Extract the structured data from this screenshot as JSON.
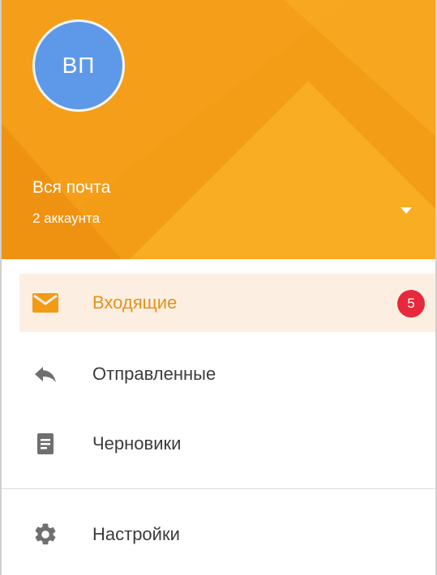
{
  "header": {
    "avatar_initials": "ВП",
    "account_title": "Вся почта",
    "account_subtitle": "2 аккаунта",
    "switch_icon": "caret-down-icon",
    "colors": {
      "background": "#f39c16",
      "avatar": "#5e99e9"
    }
  },
  "nav": {
    "items": [
      {
        "label": "Входящие",
        "icon": "envelope-icon",
        "badge": "5",
        "active": true
      },
      {
        "label": "Отправленные",
        "icon": "reply-icon",
        "active": false
      },
      {
        "label": "Черновики",
        "icon": "document-icon",
        "active": false
      }
    ],
    "settings": {
      "label": "Настройки",
      "icon": "gear-icon"
    }
  },
  "colors": {
    "accent": "#e5911a",
    "active_background": "#fcefe1",
    "badge": "#e8283c",
    "icon_gray": "#6f6f6f"
  }
}
